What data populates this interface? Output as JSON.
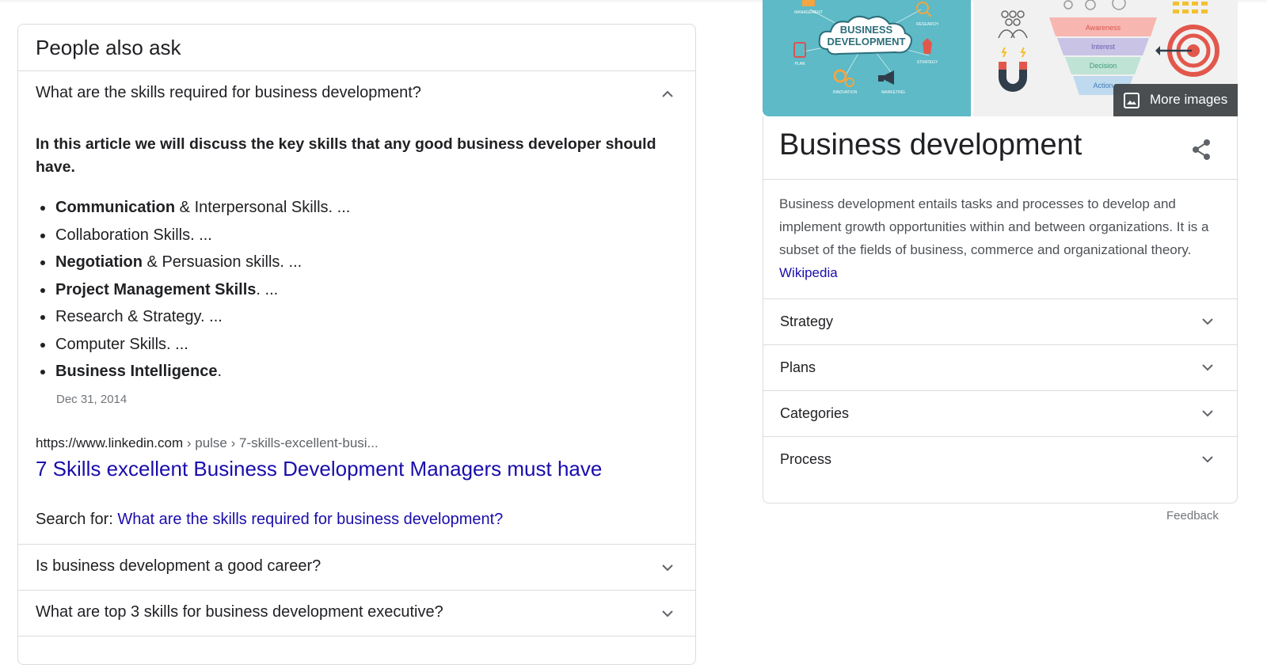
{
  "paa": {
    "title": "People also ask",
    "expanded_question": "What are the skills required for business development?",
    "answer": {
      "lead": "In this article we will discuss the key skills that any good business developer should have.",
      "bullets": [
        {
          "bold": "Communication",
          "rest": " & Interpersonal Skills. ..."
        },
        {
          "bold": "",
          "rest": "Collaboration Skills. ..."
        },
        {
          "bold": "Negotiation",
          "rest": " & Persuasion skills. ..."
        },
        {
          "bold": "Project Management Skills",
          "rest": ". ..."
        },
        {
          "bold": "",
          "rest": "Research & Strategy. ..."
        },
        {
          "bold": "",
          "rest": "Computer Skills. ..."
        },
        {
          "bold": "Business Intelligence",
          "rest": "."
        }
      ],
      "date": "Dec 31, 2014"
    },
    "source": {
      "domain": "https://www.linkedin.com",
      "path": " › pulse › 7-skills-excellent-busi...",
      "title": "7 Skills excellent Business Development Managers must have"
    },
    "search_for": {
      "prefix": "Search for: ",
      "query": "What are the skills required for business development?"
    },
    "other_questions": [
      "Is business development a good career?",
      "What are top 3 skills for business development executive?"
    ]
  },
  "knowledge_panel": {
    "images": {
      "more_images_label": "More images",
      "image1_text": [
        "BUSINESS",
        "DEVELOPMENT"
      ],
      "image1_labels": [
        "MANAGEMENT",
        "RESEARCH",
        "PLAN",
        "STRATEGY",
        "INNOVATION",
        "MARKETING"
      ],
      "funnel_labels": [
        "Awareness",
        "Interest",
        "Decision",
        "Action"
      ]
    },
    "title": "Business development",
    "description": "Business development entails tasks and processes to develop and implement growth opportunities within and between organizations. It is a subset of the fields of business, commerce and organizational theory. ",
    "source_link": "Wikipedia",
    "sections": [
      "Strategy",
      "Plans",
      "Categories",
      "Process"
    ],
    "feedback": "Feedback"
  },
  "colors": {
    "link": "#1a0dab",
    "text": "#202124",
    "secondary": "#70757a",
    "border": "#dadce0",
    "image1_bg": "#5dbac6"
  },
  "icons": {
    "expanded": "chevron-up-icon",
    "collapsed": "chevron-down-icon",
    "share": "share-icon",
    "more_images": "image-icon"
  }
}
